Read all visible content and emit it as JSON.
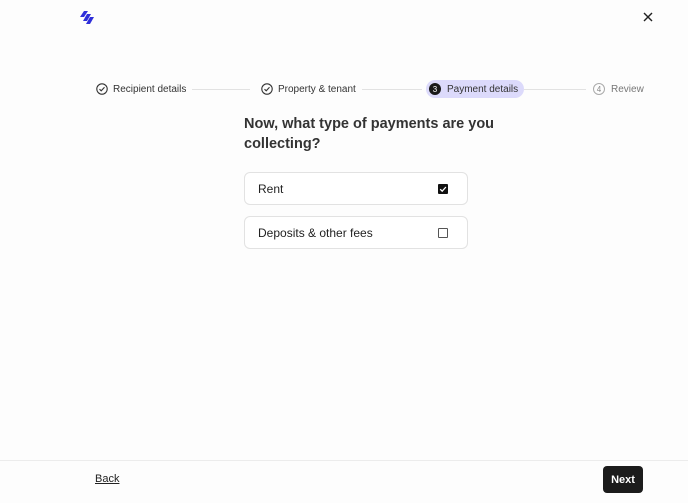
{
  "header": {
    "logo_icon": "brand-logo-icon",
    "close_icon": "close-icon",
    "brand_color": "#2f2fd9"
  },
  "stepper": {
    "steps": [
      {
        "label": "Recipient details",
        "status": "completed",
        "icon": "check-circle-icon"
      },
      {
        "label": "Property & tenant",
        "status": "completed",
        "icon": "check-circle-icon"
      },
      {
        "label": "Payment details",
        "status": "active",
        "number": "3"
      },
      {
        "label": "Review",
        "status": "pending",
        "number": "4"
      }
    ],
    "active_bg": "#dcdafb"
  },
  "main": {
    "question": "Now, what type of payments are you collecting?",
    "options": [
      {
        "label": "Rent",
        "checked": true
      },
      {
        "label": "Deposits & other fees",
        "checked": false
      }
    ]
  },
  "footer": {
    "back_label": "Back",
    "next_label": "Next"
  }
}
